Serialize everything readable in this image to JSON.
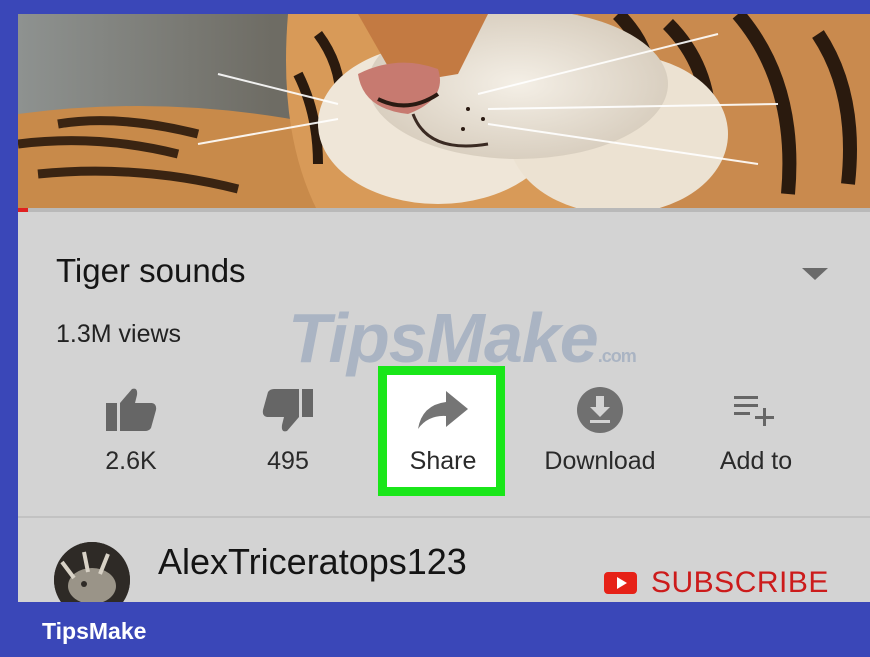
{
  "video": {
    "title": "Tiger sounds",
    "views": "1.3M views",
    "progress": 0.012
  },
  "actions": [
    {
      "label": "2.6K",
      "icon": "thumbs-up-icon"
    },
    {
      "label": "495",
      "icon": "thumbs-down-icon"
    },
    {
      "label": "Share",
      "icon": "share-arrow-icon",
      "highlighted": true
    },
    {
      "label": "Download",
      "icon": "download-icon"
    },
    {
      "label": "Add to",
      "icon": "add-to-playlist-icon"
    }
  ],
  "channel": {
    "name": "AlexTriceratops123",
    "subscribe_label": "SUBSCRIBE"
  },
  "watermark": {
    "text": "TipsMake",
    "suffix": ".com"
  },
  "footer": {
    "brand": "TipsMake"
  },
  "colors": {
    "frame": "#3a47b8",
    "highlight": "#19e619",
    "subscribe": "#cc1b1b",
    "progress": "#e02020"
  }
}
